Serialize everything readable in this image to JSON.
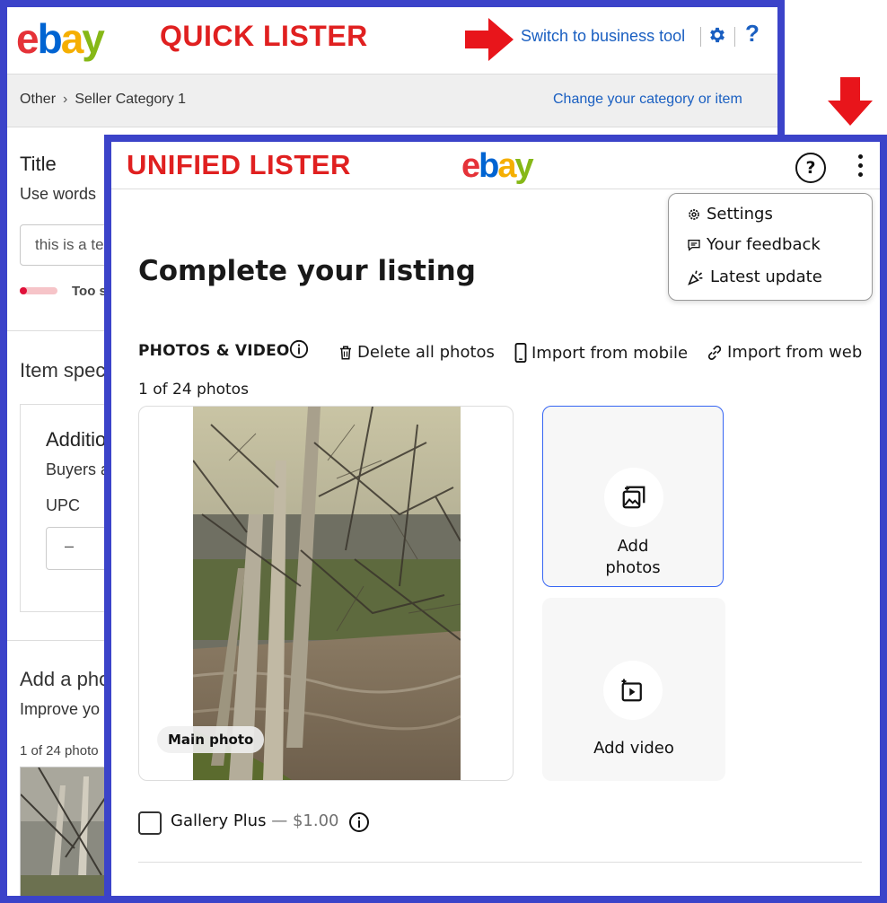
{
  "quick_lister": {
    "logo": {
      "e": "e",
      "b": "b",
      "a": "a",
      "y": "y"
    },
    "label": "QUICK LISTER",
    "switch_link": "Switch to business tool",
    "help_glyph": "?",
    "breadcrumb": {
      "level1": "Other",
      "level2": "Seller Category 1"
    },
    "change_link": "Change your category or item",
    "title_section": {
      "heading": "Title",
      "help": "Use words",
      "input_value": "this is a te",
      "meter_text": "Too s",
      "meter_fill": 0.2
    },
    "item_specifics": {
      "heading": "Item spec",
      "additional_heading": "Additio",
      "additional_sub": "Buyers a",
      "upc_label": "UPC",
      "upc_value": "–"
    },
    "photos_section": {
      "heading": "Add a pho",
      "sub": "Improve yo",
      "count": "1 of 24 photo"
    }
  },
  "unified_lister": {
    "label": "UNIFIED LISTER",
    "logo": {
      "e": "e",
      "b": "b",
      "a": "a",
      "y": "y"
    },
    "help_glyph": "?",
    "menu": {
      "settings": "Settings",
      "feedback": "Your feedback",
      "latest": "Latest update"
    },
    "page_title": "Complete your listing",
    "photos_video": {
      "label": "PHOTOS & VIDEO",
      "delete_all": "Delete all photos",
      "import_mobile": "Import from mobile",
      "import_web": "Import from web",
      "photo_count": "1 of 24 photos",
      "main_photo_label": "Main photo",
      "add_photos_line1": "Add",
      "add_photos_line2": "photos",
      "add_video": "Add video"
    },
    "gallery_plus": {
      "label": "Gallery Plus",
      "dash": " — ",
      "price": "$1.00",
      "checked": false
    }
  },
  "colors": {
    "frame": "#3b43c9",
    "label_red": "#e02020",
    "link_blue": "#1a5fc1",
    "ebay_red": "#e53238",
    "ebay_blue": "#0064d2",
    "ebay_yellow": "#f5af02",
    "ebay_green": "#86b817"
  }
}
